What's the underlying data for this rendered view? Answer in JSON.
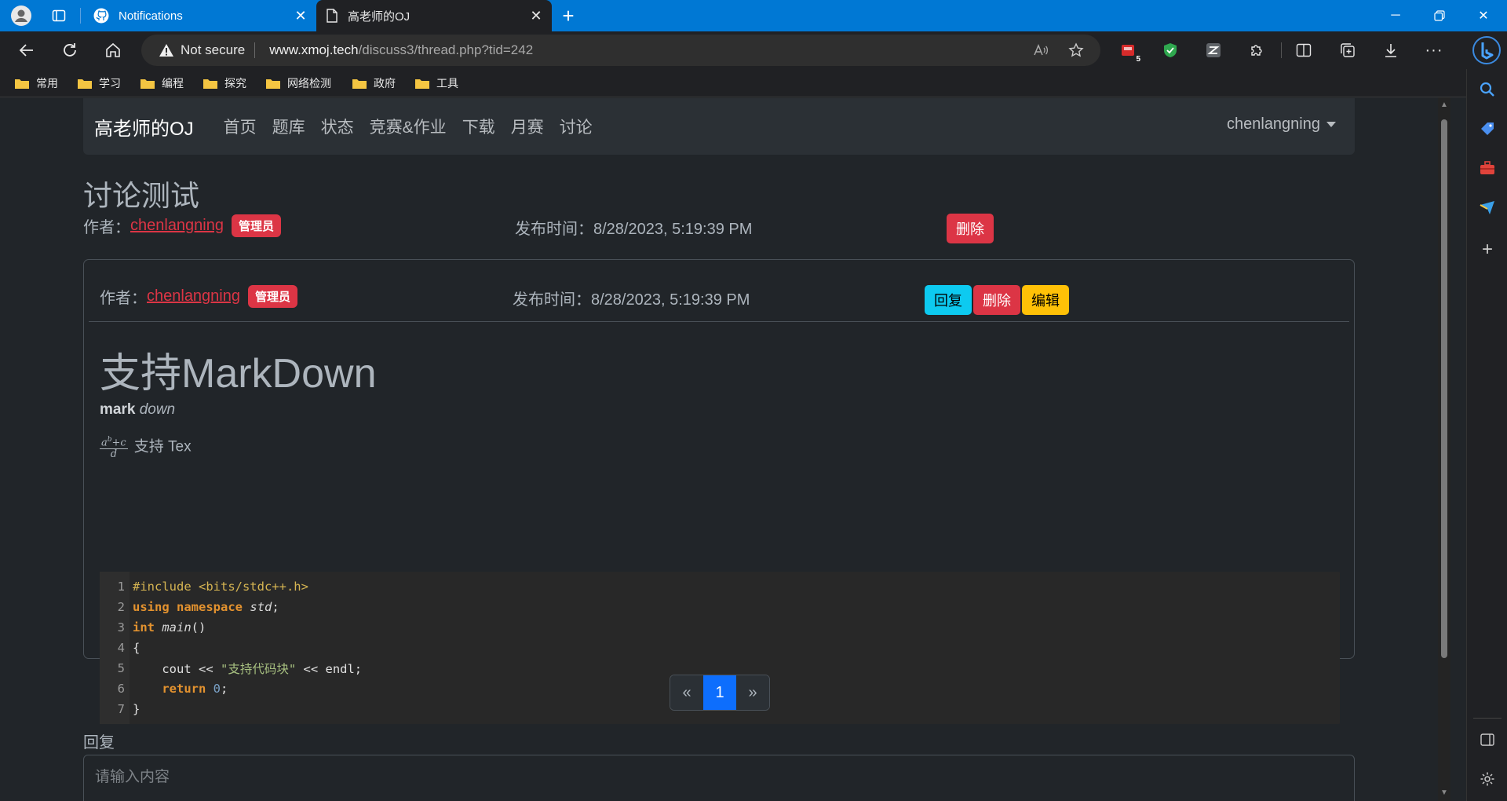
{
  "browser": {
    "tabs": [
      {
        "title": "Notifications",
        "active": false,
        "icon": "github-icon"
      },
      {
        "title": "高老师的OJ",
        "active": true,
        "icon": "page-icon"
      }
    ],
    "address": {
      "security_text": "Not secure",
      "host": "www.xmoj.tech",
      "path": "/discuss3/thread.php?tid=242"
    },
    "extension_badge": "5",
    "bookmarks": [
      "常用",
      "学习",
      "编程",
      "探究",
      "网络检测",
      "政府",
      "工具"
    ],
    "colors": {
      "tabstrip": "#0078d4",
      "chrome": "#202124"
    }
  },
  "site": {
    "brand": "高老师的OJ",
    "nav": [
      "首页",
      "题库",
      "状态",
      "竞赛&作业",
      "下载",
      "月赛",
      "讨论"
    ],
    "user": "chenlangning"
  },
  "thread": {
    "title": "讨论测试",
    "author_label": "作者：",
    "author": "chenlangning",
    "badge": "管理员",
    "time_label": "发布时间：8/28/2023, 5:19:39 PM",
    "delete_label": "删除"
  },
  "post": {
    "author_label": "作者：",
    "author": "chenlangning",
    "badge": "管理员",
    "time_label": "发布时间：8/28/2023, 5:19:39 PM",
    "reply_label": "回复",
    "delete_label": "删除",
    "edit_label": "编辑",
    "heading": "支持MarkDown",
    "bold_text": "mark",
    "italic_text": "down",
    "tex_numerator": "a",
    "tex_sup": "b",
    "tex_plus": "+c",
    "tex_denominator": "d",
    "tex_text": "支持 Tex",
    "code_lines": [
      {
        "n": "1"
      },
      {
        "n": "2"
      },
      {
        "n": "3"
      },
      {
        "n": "4"
      },
      {
        "n": "5"
      },
      {
        "n": "6"
      },
      {
        "n": "7"
      }
    ],
    "code": {
      "l1": "#include <bits/stdc++.h>",
      "l2_kw1": "using",
      "l2_kw2": "namespace",
      "l2_it": "std",
      "l2_end": ";",
      "l3_kw": "int",
      "l3_it": "main",
      "l3_end": "()",
      "l4": "{",
      "l5_a": "    cout << ",
      "l5_str": "\"支持代码块\"",
      "l5_b": " << endl;",
      "l6_kw": "return",
      "l6_num": "0",
      "l6_end": ";",
      "l7": "}"
    }
  },
  "pager": {
    "prev": "«",
    "current": "1",
    "next": "»"
  },
  "reply": {
    "label": "回复",
    "placeholder": "请输入内容"
  },
  "theme": {
    "danger": "#dc3545",
    "info": "#0dcaf0",
    "warning": "#ffc107",
    "primary": "#0d6efd"
  }
}
